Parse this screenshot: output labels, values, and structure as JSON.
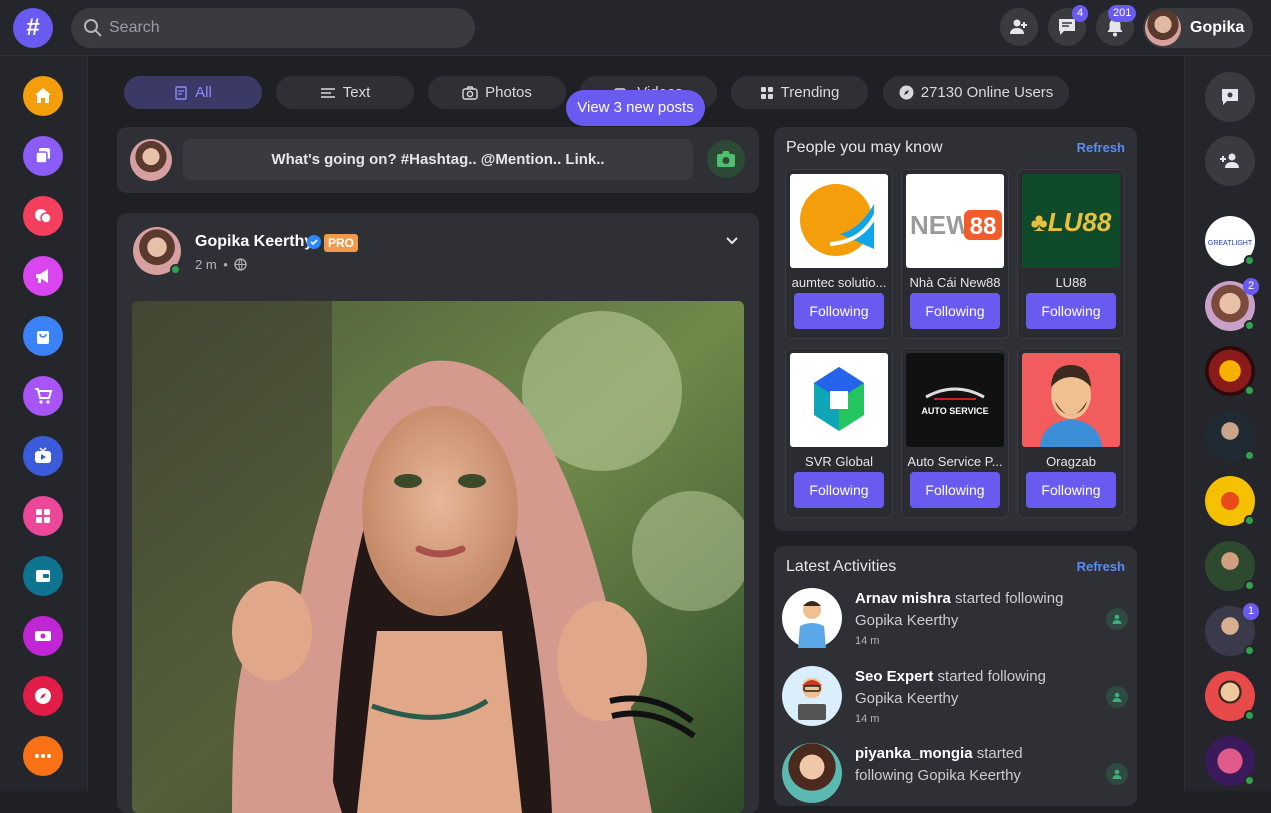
{
  "header": {
    "logo_glyph": "#",
    "search_placeholder": "Search",
    "messages_badge": "4",
    "notifications_badge": "201",
    "user_name": "Gopika"
  },
  "tabs": [
    {
      "label": "All",
      "icon": "document-icon",
      "active": true
    },
    {
      "label": "Text",
      "icon": "text-lines-icon"
    },
    {
      "label": "Photos",
      "icon": "camera-icon"
    },
    {
      "label": "Videos",
      "icon": "video-icon"
    },
    {
      "label": "Trending",
      "icon": "grid-icon"
    },
    {
      "label": "27130 Online Users",
      "icon": "compass-icon"
    }
  ],
  "new_posts_label": "View 3 new posts",
  "composer": {
    "placeholder": "What's going on? #Hashtag.. @Mention.. Link.."
  },
  "post": {
    "author": "Gopika Keerthy",
    "pro_badge": "PRO",
    "time": "2 m",
    "separator": "•"
  },
  "people": {
    "title": "People you may know",
    "refresh": "Refresh",
    "cards": [
      {
        "name": "aumtec solutio...",
        "button": "Following",
        "bg": "#ffffff"
      },
      {
        "name": "Nhà Cái New88",
        "button": "Following",
        "bg": "#ffffff",
        "logo_text": "NEW88"
      },
      {
        "name": "LU88",
        "button": "Following",
        "bg": "#0f4a2a",
        "logo_text": "LU88"
      },
      {
        "name": "SVR Global",
        "button": "Following",
        "bg": "#ffffff"
      },
      {
        "name": "Auto Service P...",
        "button": "Following",
        "bg": "#111111",
        "logo_text": "AUTO SERVICE"
      },
      {
        "name": "Oragzab",
        "button": "Following",
        "bg": "#f25c5c"
      }
    ]
  },
  "activities": {
    "title": "Latest Activities",
    "refresh": "Refresh",
    "items": [
      {
        "user": "Arnav mishra",
        "text": " started following Gopika Keerthy",
        "time": "14 m"
      },
      {
        "user": "Seo Expert",
        "text": " started following Gopika Keerthy",
        "time": "14 m"
      },
      {
        "user": "piyanka_mongia",
        "text": " started following Gopika Keerthy",
        "time": ""
      }
    ]
  },
  "right_sidebar": {
    "avatar_badges": [
      "",
      "2",
      "",
      "",
      "",
      "",
      "1",
      "",
      ""
    ]
  },
  "colors": {
    "accent": "#6a5bf0",
    "background": "#1f2023",
    "panel": "#2e3035",
    "online": "#31a24c",
    "pro": "#f2994a",
    "refresh": "#5b8cf0"
  }
}
